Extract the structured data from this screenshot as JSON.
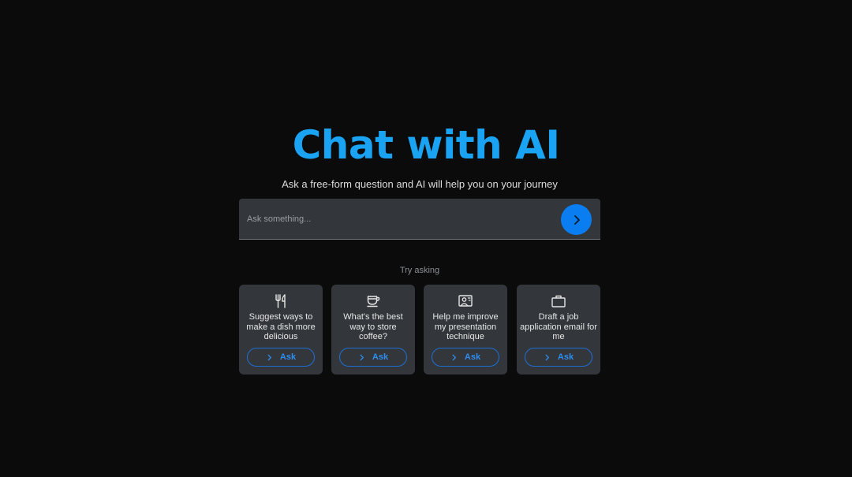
{
  "header": {
    "title": "Chat with AI",
    "subtitle": "Ask a free-form question and AI will help you on your journey"
  },
  "search": {
    "placeholder": "Ask something...",
    "value": "",
    "send_icon": "chevron-right-icon"
  },
  "suggestions": {
    "label": "Try asking",
    "items": [
      {
        "icon": "utensils-icon",
        "text": "Suggest ways to make a dish more delicious",
        "button_label": "Ask"
      },
      {
        "icon": "coffee-cup-icon",
        "text": "What's the best way to store coffee?",
        "button_label": "Ask"
      },
      {
        "icon": "presentation-icon",
        "text": "Help me improve my presentation technique",
        "button_label": "Ask"
      },
      {
        "icon": "briefcase-icon",
        "text": "Draft a job application email for me",
        "button_label": "Ask"
      }
    ]
  },
  "colors": {
    "background": "#0b0b0b",
    "title": "#1aa3f2",
    "accent": "#0a7ef0",
    "card": "#33373b"
  }
}
